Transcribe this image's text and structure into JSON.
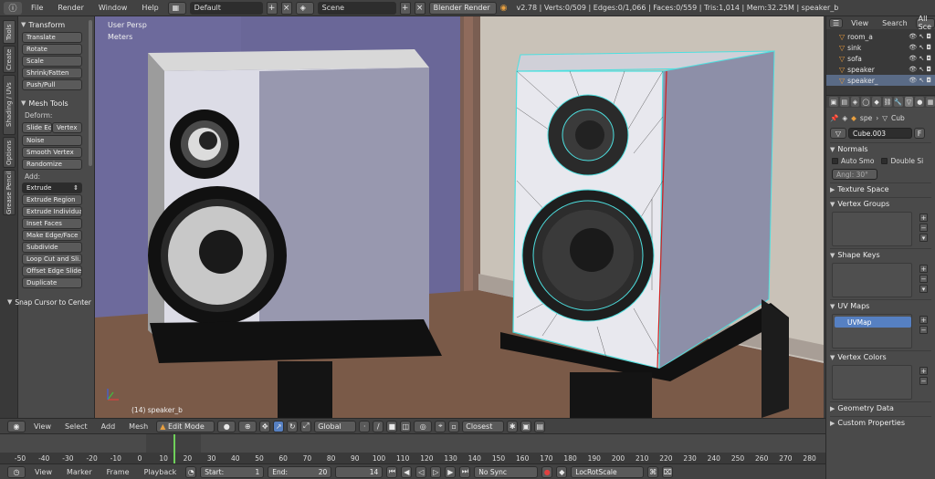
{
  "topbar": {
    "menus": [
      "File",
      "Render",
      "Window",
      "Help"
    ],
    "screen_layout": "Default",
    "scene": "Scene",
    "render_engine": "Blender Render",
    "stats": "v2.78 | Verts:0/509 | Edges:0/1,066 | Faces:0/559 | Tris:1,014 | Mem:32.25M | speaker_b"
  },
  "vtabs": [
    "Tools",
    "Create",
    "Shading / UVs",
    "Options",
    "Grease Pencil"
  ],
  "toolshelf": {
    "transform_header": "Transform",
    "transform_tools": [
      "Translate",
      "Rotate",
      "Scale",
      "Shrink/Fatten",
      "Push/Pull"
    ],
    "mesh_tools_header": "Mesh Tools",
    "deform_label": "Deform:",
    "slide_edge": "Slide Ed",
    "vertex": "Vertex",
    "deform_tools": [
      "Noise",
      "Smooth Vertex",
      "Randomize"
    ],
    "add_label": "Add:",
    "extrude": "Extrude",
    "add_tools": [
      "Extrude Region",
      "Extrude Individual",
      "Inset Faces",
      "Make Edge/Face",
      "Subdivide",
      "Loop Cut and Sli...",
      "Offset Edge Slide",
      "Duplicate"
    ],
    "snap_header": "Snap Cursor to Center"
  },
  "viewport": {
    "persp_label": "User Persp",
    "units_label": "Meters",
    "object_label": "(14) speaker_b"
  },
  "vp_header": {
    "view": "View",
    "select": "Select",
    "add": "Add",
    "mesh": "Mesh",
    "mode": "Edit Mode",
    "orientation": "Global",
    "snap_target": "Closest"
  },
  "timeline": {
    "ticks": [
      -50,
      -40,
      -30,
      -20,
      -10,
      0,
      10,
      20,
      30,
      40,
      50,
      60,
      70,
      80,
      90,
      100,
      110,
      120,
      130,
      140,
      150,
      160,
      170,
      180,
      190,
      200,
      210,
      220,
      230,
      240,
      250,
      260,
      270,
      280
    ],
    "current_frame_tick": 14
  },
  "bottombar": {
    "view": "View",
    "marker": "Marker",
    "frame": "Frame",
    "playback": "Playback",
    "start_label": "Start:",
    "start_value": "1",
    "end_label": "End:",
    "end_value": "20",
    "current": "14",
    "sync": "No Sync",
    "keying_set": "LocRotScale"
  },
  "outliner": {
    "view": "View",
    "search": "Search",
    "filter": "All Sce",
    "items": [
      "room_a",
      "sink",
      "sofa",
      "speaker",
      "speaker_"
    ]
  },
  "properties": {
    "crumb_obj": "spe",
    "crumb_mesh": "Cub",
    "mesh_name": "Cube.003",
    "fake_user": "F",
    "normals": "Normals",
    "auto_smooth": "Auto Smo",
    "double_sided": "Double Si",
    "angle": "Angl: 30°",
    "texture_space": "Texture Space",
    "vertex_groups": "Vertex Groups",
    "shape_keys": "Shape Keys",
    "uv_maps": "UV Maps",
    "uv_map_item": "UVMap",
    "vertex_colors": "Vertex Colors",
    "geometry_data": "Geometry Data",
    "custom_properties": "Custom Properties"
  }
}
